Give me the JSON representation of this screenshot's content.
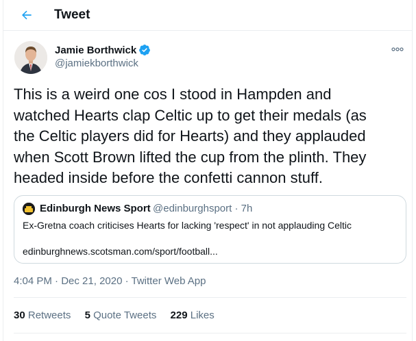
{
  "header": {
    "title": "Tweet",
    "back_icon": "arrow-left-icon",
    "accent": "#1da1f2"
  },
  "author": {
    "name": "Jamie Borthwick",
    "handle": "@jamiekborthwick",
    "verified": true,
    "verified_icon": "verified-badge-icon"
  },
  "more_icon": "more-horizontal-icon",
  "tweet": {
    "lines": [
      "This is a weird one cos I stood in Hampden and",
      "watched Hearts clap Celtic up to get their medals (as",
      "the Celtic players did for Hearts) and they applauded",
      "when Scott Brown lifted the cup from the plinth. They",
      "headed inside before the confetti cannon stuff."
    ]
  },
  "quote": {
    "name": "Edinburgh News Sport",
    "handle_time": "@edinburghsport · 7h",
    "text": "Ex-Gretna coach criticises Hearts for lacking 'respect' in not applauding Celtic",
    "link": "edinburghnews.scotsman.com/sport/football..."
  },
  "meta": {
    "time": "4:04 PM",
    "sep1": " · ",
    "date": "Dec 21, 2020",
    "sep2": " · ",
    "source": "Twitter Web App"
  },
  "stats": {
    "retweets_count": "30",
    "retweets_label": "Retweets",
    "quotes_count": "5",
    "quotes_label": "Quote Tweets",
    "likes_count": "229",
    "likes_label": "Likes"
  }
}
